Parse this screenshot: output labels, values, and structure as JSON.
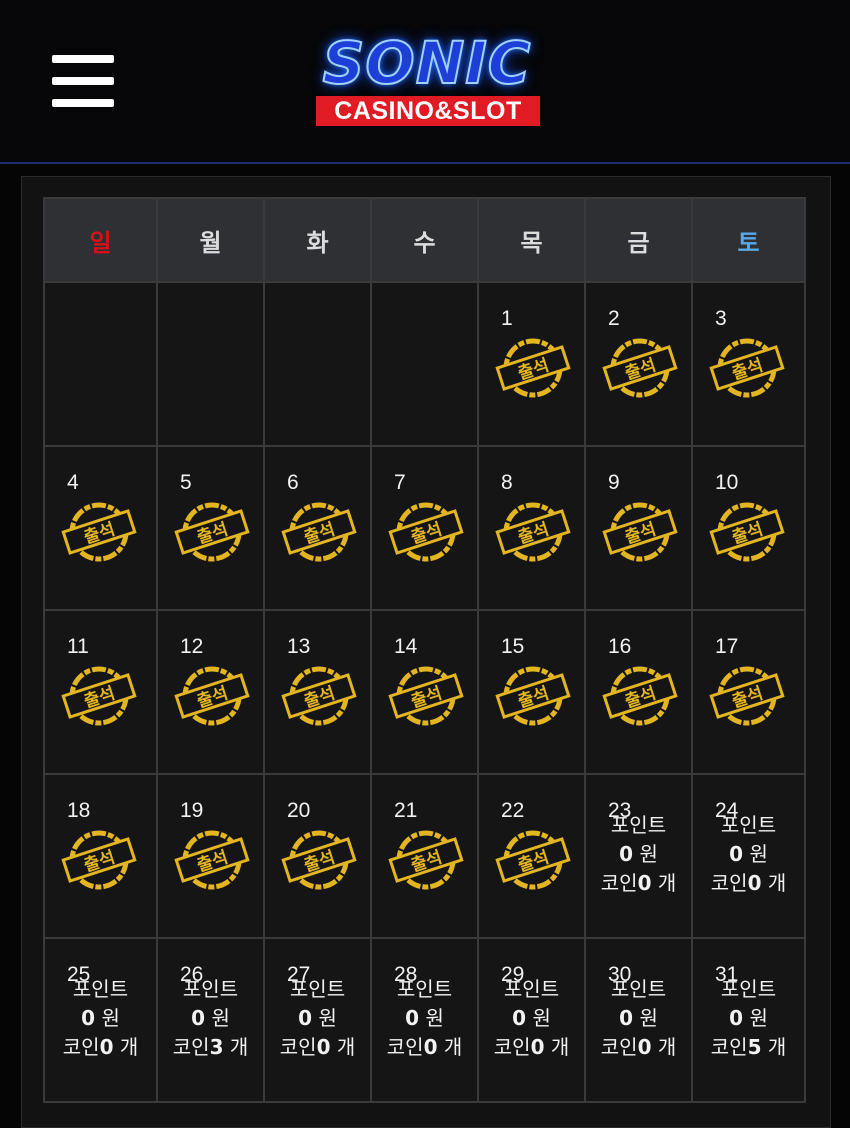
{
  "header": {
    "logo_title": "SONIC",
    "logo_subtitle": "CASINO&SLOT",
    "menu_icon": "hamburger-menu-icon"
  },
  "colors": {
    "sunday": "#d4121a",
    "saturday": "#5aa8e8",
    "stamp": "#e3b521",
    "brand_blue": "#1d3fd8",
    "brand_red": "#e01b24"
  },
  "calendar": {
    "weekdays": [
      "일",
      "월",
      "화",
      "수",
      "목",
      "금",
      "토"
    ],
    "attendance_label": "출석",
    "info_labels": {
      "point": "포인트",
      "won": "원",
      "coin": "코인",
      "count": "개"
    },
    "weeks": [
      [
        {
          "day": ""
        },
        {
          "day": ""
        },
        {
          "day": ""
        },
        {
          "day": ""
        },
        {
          "day": "1",
          "attended": true
        },
        {
          "day": "2",
          "attended": true
        },
        {
          "day": "3",
          "attended": true
        }
      ],
      [
        {
          "day": "4",
          "attended": true
        },
        {
          "day": "5",
          "attended": true
        },
        {
          "day": "6",
          "attended": true
        },
        {
          "day": "7",
          "attended": true
        },
        {
          "day": "8",
          "attended": true
        },
        {
          "day": "9",
          "attended": true
        },
        {
          "day": "10",
          "attended": true
        }
      ],
      [
        {
          "day": "11",
          "attended": true
        },
        {
          "day": "12",
          "attended": true
        },
        {
          "day": "13",
          "attended": true
        },
        {
          "day": "14",
          "attended": true
        },
        {
          "day": "15",
          "attended": true
        },
        {
          "day": "16",
          "attended": true
        },
        {
          "day": "17",
          "attended": true
        }
      ],
      [
        {
          "day": "18",
          "attended": true
        },
        {
          "day": "19",
          "attended": true
        },
        {
          "day": "20",
          "attended": true
        },
        {
          "day": "21",
          "attended": true
        },
        {
          "day": "22",
          "attended": true
        },
        {
          "day": "23",
          "attended": false,
          "points": "0",
          "coins": "0"
        },
        {
          "day": "24",
          "attended": false,
          "points": "0",
          "coins": "0"
        }
      ],
      [
        {
          "day": "25",
          "attended": false,
          "points": "0",
          "coins": "0"
        },
        {
          "day": "26",
          "attended": false,
          "points": "0",
          "coins": "3"
        },
        {
          "day": "27",
          "attended": false,
          "points": "0",
          "coins": "0"
        },
        {
          "day": "28",
          "attended": false,
          "points": "0",
          "coins": "0"
        },
        {
          "day": "29",
          "attended": false,
          "points": "0",
          "coins": "0"
        },
        {
          "day": "30",
          "attended": false,
          "points": "0",
          "coins": "0"
        },
        {
          "day": "31",
          "attended": false,
          "points": "0",
          "coins": "5"
        }
      ]
    ]
  }
}
